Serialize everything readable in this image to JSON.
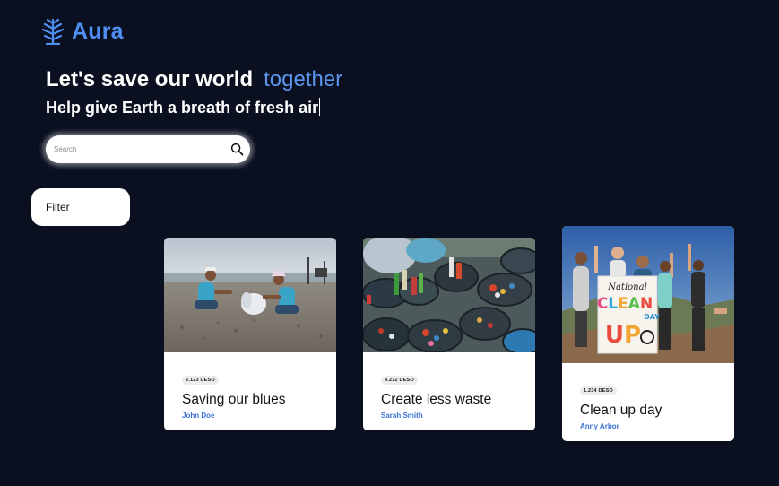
{
  "brand": {
    "name": "Aura",
    "icon": "leaf-icon",
    "color": "#4f8ef2"
  },
  "hero": {
    "title": "Let's save our world",
    "title_accent": "together",
    "subtitle": "Help give Earth a breath of fresh air"
  },
  "search": {
    "placeholder": "Search",
    "icon": "search-icon"
  },
  "filter": {
    "label": "Filter"
  },
  "cards": [
    {
      "badge": "2.123 DESO",
      "title": "Saving our blues",
      "author": "John Doe",
      "image": "beach-cleanup-photo"
    },
    {
      "badge": "4.212 DESO",
      "title": "Create less waste",
      "author": "Sarah Smith",
      "image": "recycling-buckets-photo"
    },
    {
      "badge": "1.234 DESO",
      "title": "Clean up day",
      "author": "Anny Arbor",
      "image": "clean-up-day-group-photo",
      "image_sign_text": [
        "National",
        "CLEAN",
        "DAY",
        "UP"
      ]
    }
  ],
  "colors": {
    "background": "#0a1020",
    "accent": "#5b95ee",
    "author_link": "#3a72d6"
  }
}
